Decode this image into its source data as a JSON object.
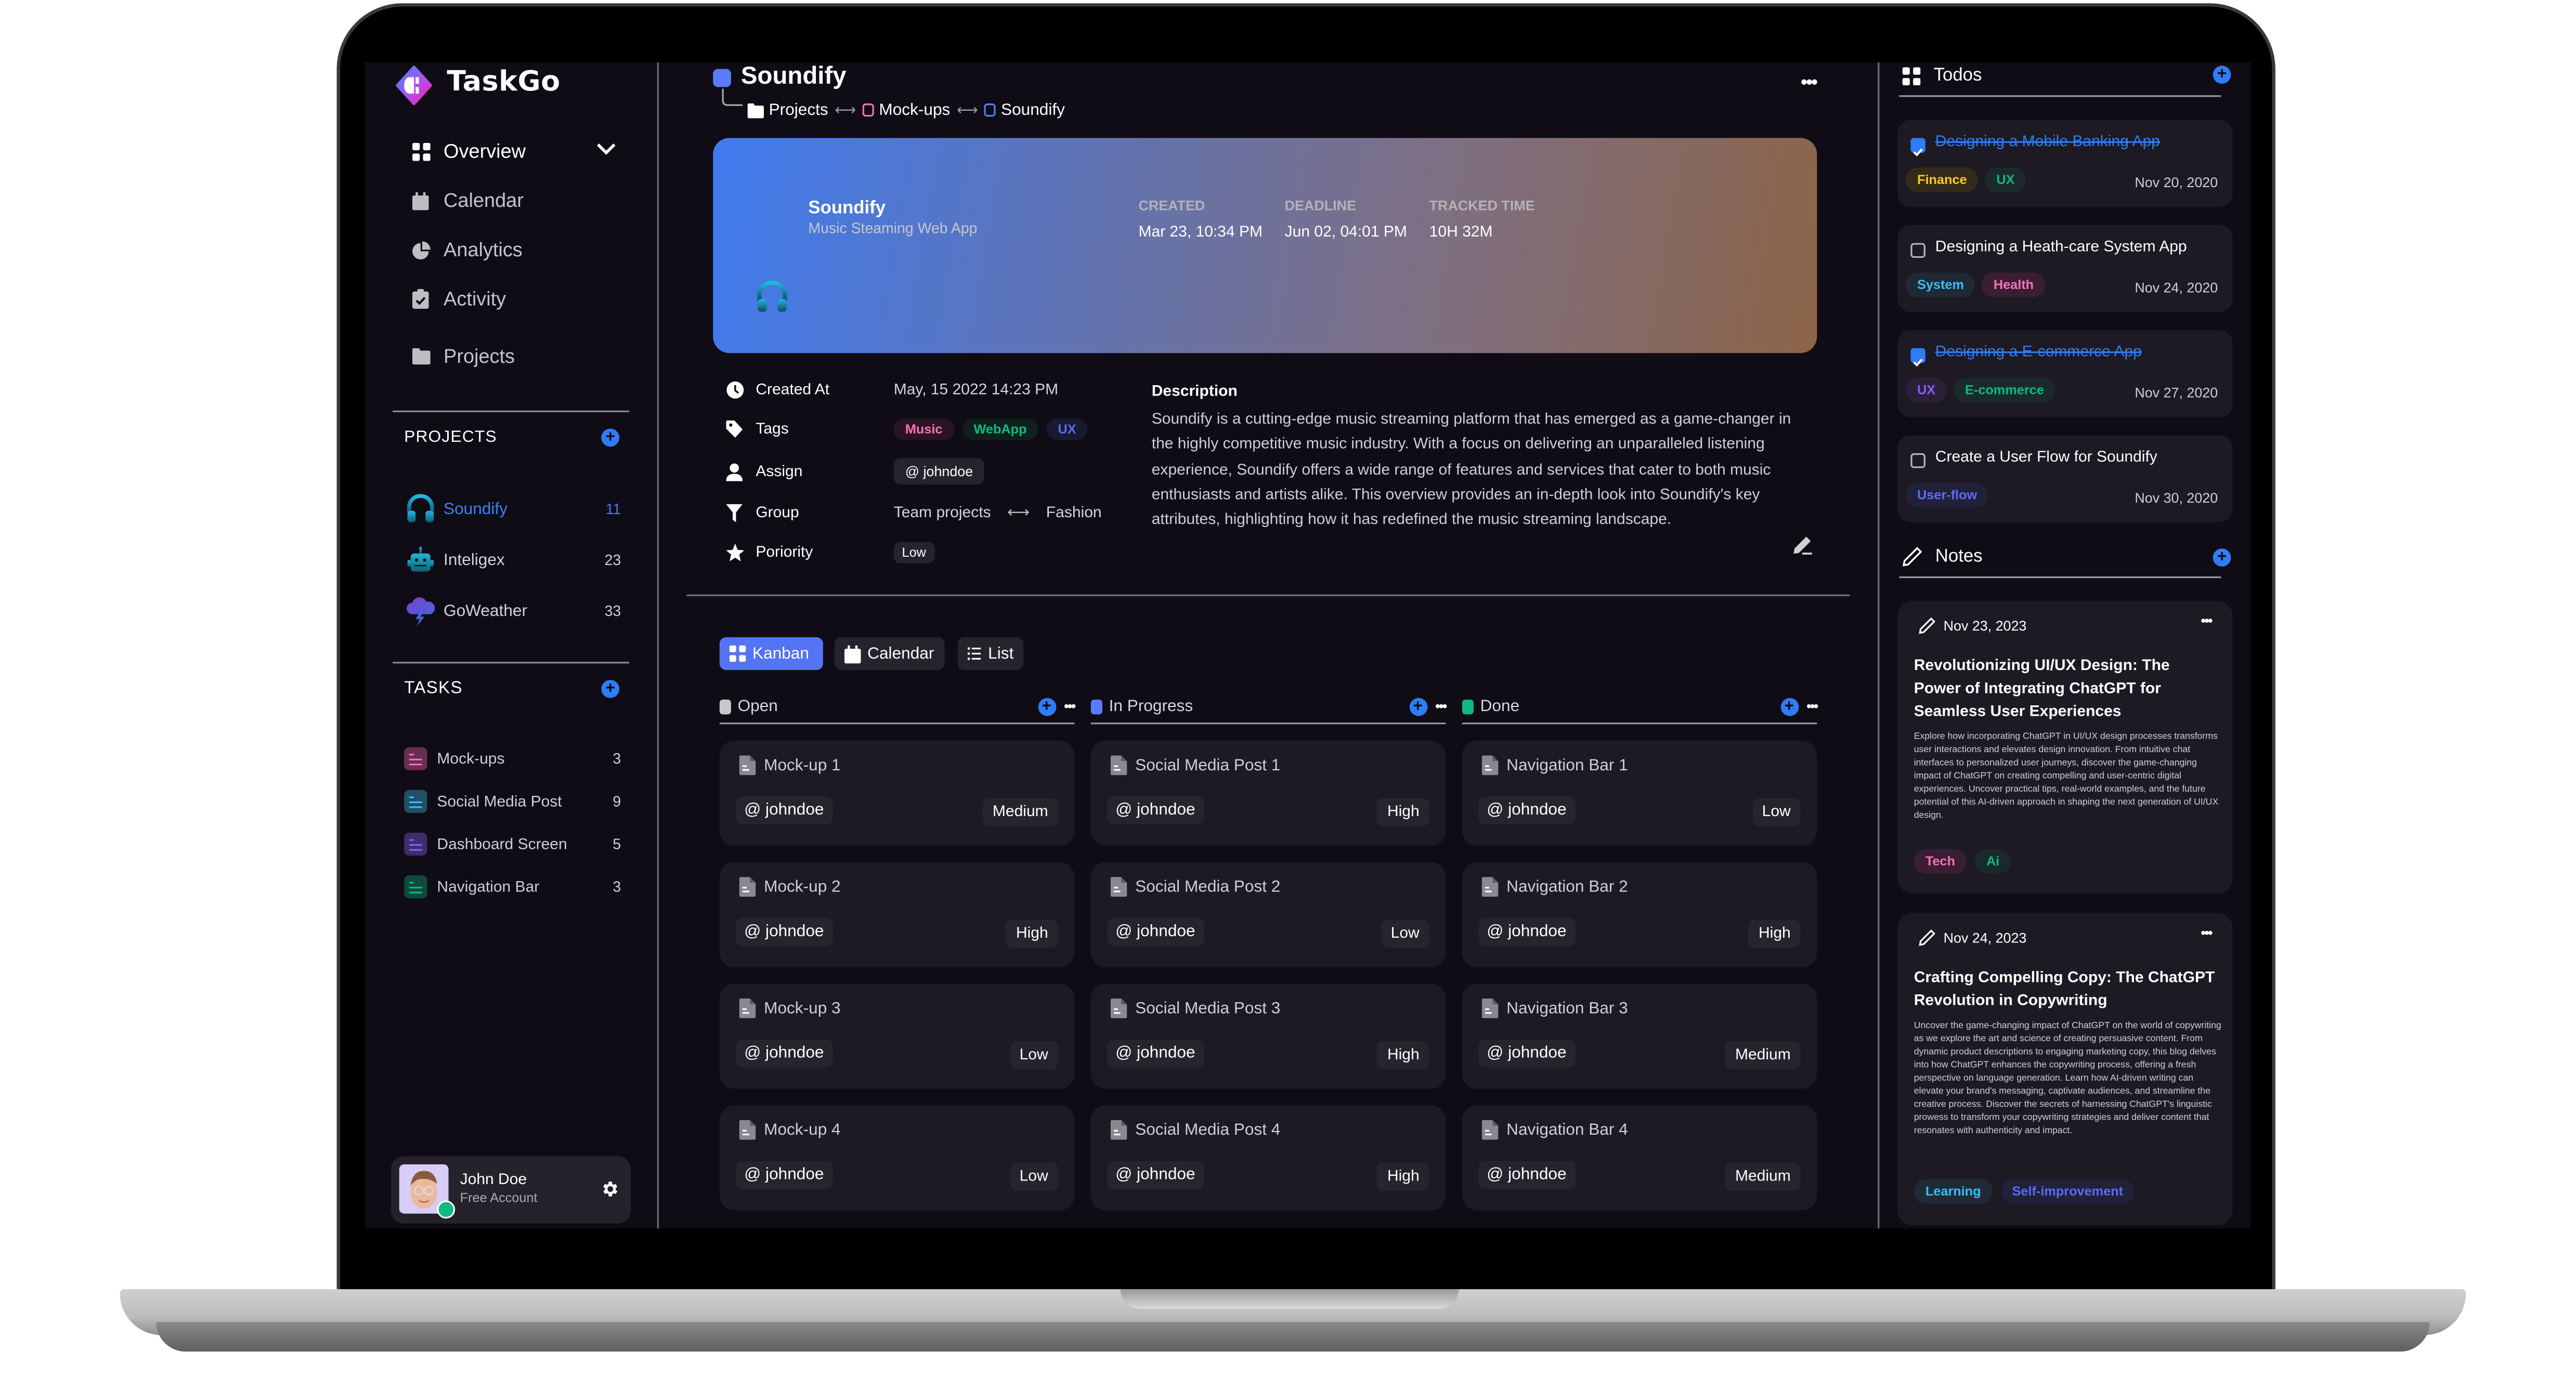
{
  "app": {
    "name": "TaskGo"
  },
  "sidebar": {
    "nav": [
      {
        "label": "Overview",
        "icon": "grid-icon",
        "active": true,
        "expandable": true
      },
      {
        "label": "Calendar",
        "icon": "calendar-icon"
      },
      {
        "label": "Analytics",
        "icon": "pie-chart-icon"
      },
      {
        "label": "Activity",
        "icon": "clipboard-check-icon"
      },
      {
        "label": "Projects",
        "icon": "folder-icon"
      }
    ],
    "projects_title": "PROJECTS",
    "projects": [
      {
        "name": "Soundify",
        "count": "11",
        "icon": "headphones-icon",
        "active": true
      },
      {
        "name": "Inteligex",
        "count": "23",
        "icon": "robot-icon"
      },
      {
        "name": "GoWeather",
        "count": "33",
        "icon": "storm-cloud-icon"
      }
    ],
    "tasks_title": "TASKS",
    "tasks": [
      {
        "name": "Mock-ups",
        "count": "3",
        "bg": "#6b2d50",
        "fg": "#f472b6"
      },
      {
        "name": "Social Media Post",
        "count": "9",
        "bg": "#1e5068",
        "fg": "#38bdf8"
      },
      {
        "name": "Dashboard Screen",
        "count": "5",
        "bg": "#3a2e6b",
        "fg": "#8b5cf6"
      },
      {
        "name": "Navigation Bar",
        "count": "3",
        "bg": "#0f4a3a",
        "fg": "#10b981"
      }
    ],
    "user": {
      "name": "John Doe",
      "plan": "Free Account",
      "status": "online"
    }
  },
  "main": {
    "title": "Soundify",
    "breadcrumb": [
      {
        "label": "Projects",
        "icon": "folder-icon"
      },
      {
        "label": "Mock-ups",
        "color": "#f472b6"
      },
      {
        "label": "Soundify",
        "color": "#5b7cfa"
      }
    ],
    "hero": {
      "name": "Soundify",
      "subtitle": "Music Steaming Web App",
      "created_label": "CREATED",
      "created": "Mar 23, 10:34 PM",
      "deadline_label": "DEADLINE",
      "deadline": "Jun 02, 04:01 PM",
      "tracked_label": "TRACKED TIME",
      "tracked": "10H 32M"
    },
    "properties": {
      "created_at_label": "Created At",
      "created_at": "May, 15 2022 14:23 PM",
      "tags_label": "Tags",
      "tags": [
        {
          "label": "Music",
          "color": "#f472b6",
          "bg": "#2a1424"
        },
        {
          "label": "WebApp",
          "color": "#10b981",
          "bg": "#10201d"
        },
        {
          "label": "UX",
          "color": "#5b6cf5",
          "bg": "#191a30"
        }
      ],
      "assign_label": "Assign",
      "assignee": "@ johndoe",
      "group_label": "Group",
      "group_from": "Team projects",
      "group_to": "Fashion",
      "priority_label": "Poriority",
      "priority": "Low"
    },
    "description_title": "Description",
    "description": "Soundify is a cutting-edge music streaming platform that has emerged as a game-changer in the highly competitive music industry. With a focus on delivering an unparalleled listening experience, Soundify offers a wide range of features and services that cater to both music enthusiasts and artists alike. This overview provides an in-depth look into Soundify's key attributes, highlighting how it has redefined the music streaming landscape.",
    "views": [
      {
        "label": "Kanban",
        "active": true
      },
      {
        "label": "Calendar"
      },
      {
        "label": "List"
      }
    ],
    "columns": [
      {
        "title": "Open",
        "color": "#c8c8cc",
        "cards": [
          {
            "title": "Mock-up 1",
            "assignee": "@ johndoe",
            "priority": "Medium"
          },
          {
            "title": "Mock-up 2",
            "assignee": "@ johndoe",
            "priority": "High"
          },
          {
            "title": "Mock-up 3",
            "assignee": "@ johndoe",
            "priority": "Low"
          },
          {
            "title": "Mock-up 4",
            "assignee": "@ johndoe",
            "priority": "Low"
          }
        ]
      },
      {
        "title": "In Progress",
        "color": "#5b7cfa",
        "cards": [
          {
            "title": "Social Media Post 1",
            "assignee": "@ johndoe",
            "priority": "High"
          },
          {
            "title": "Social Media Post 2",
            "assignee": "@ johndoe",
            "priority": "Low"
          },
          {
            "title": "Social Media Post 3",
            "assignee": "@ johndoe",
            "priority": "High"
          },
          {
            "title": "Social Media Post 4",
            "assignee": "@ johndoe",
            "priority": "High"
          }
        ]
      },
      {
        "title": "Done",
        "color": "#10b981",
        "cards": [
          {
            "title": "Navigation Bar 1",
            "assignee": "@ johndoe",
            "priority": "Low"
          },
          {
            "title": "Navigation Bar 2",
            "assignee": "@ johndoe",
            "priority": "High"
          },
          {
            "title": "Navigation Bar 3",
            "assignee": "@ johndoe",
            "priority": "Medium"
          },
          {
            "title": "Navigation Bar 4",
            "assignee": "@ johndoe",
            "priority": "Medium"
          }
        ]
      }
    ]
  },
  "todos": {
    "title": "Todos",
    "items": [
      {
        "title": "Designing a Mobile Banking App",
        "done": true,
        "date": "Nov 20, 2020",
        "tags": [
          {
            "label": "Finance",
            "color": "#facc15",
            "bg": "#332a1c"
          },
          {
            "label": "UX",
            "color": "#10b981",
            "bg": "#1a2a2a"
          }
        ]
      },
      {
        "title": "Designing a Heath-care System App",
        "done": false,
        "date": "Nov 24, 2020",
        "tags": [
          {
            "label": "System",
            "color": "#38bdf8",
            "bg": "#1f2a36"
          },
          {
            "label": "Health",
            "color": "#f472b6",
            "bg": "#3a1e33"
          }
        ]
      },
      {
        "title": "Designing a E-commerce App",
        "done": true,
        "date": "Nov 27, 2020",
        "tags": [
          {
            "label": "UX",
            "color": "#8b5cf6",
            "bg": "#2a2138"
          },
          {
            "label": "E-commerce",
            "color": "#10b981",
            "bg": "#1a2a2a"
          }
        ]
      },
      {
        "title": "Create a User Flow for Soundify",
        "done": false,
        "date": "Nov 30, 2020",
        "tags": [
          {
            "label": "User-flow",
            "color": "#5b6cf5",
            "bg": "#21213a"
          }
        ]
      }
    ]
  },
  "notes": {
    "title": "Notes",
    "items": [
      {
        "date": "Nov 23, 2023",
        "title": "Revolutionizing UI/UX Design: The Power of Integrating ChatGPT for Seamless User Experiences",
        "body": "Explore how incorporating ChatGPT in UI/UX design processes transforms user interactions and elevates design innovation. From intuitive chat interfaces to personalized user journeys, discover the game-changing impact of ChatGPT on creating compelling and user-centric digital experiences. Uncover practical tips, real-world examples, and the future potential of this AI-driven approach in shaping the next generation of UI/UX design.",
        "tags": [
          {
            "label": "Tech",
            "color": "#f472b6",
            "bg": "#3a1e33"
          },
          {
            "label": "Ai",
            "color": "#10b981",
            "bg": "#1a2a2a"
          }
        ]
      },
      {
        "date": "Nov 24, 2023",
        "title": "Crafting Compelling Copy: The ChatGPT Revolution in Copywriting",
        "body": "Uncover the game-changing impact of ChatGPT on the world of copywriting as we explore the art and science of creating persuasive content. From dynamic product descriptions to engaging marketing copy, this blog delves into how ChatGPT enhances the copywriting process, offering a fresh perspective on language generation. Learn how AI-driven writing can elevate your brand's messaging, captivate audiences, and streamline the creative process. Discover the secrets of harnessing ChatGPT's linguistic prowess to transform your copywriting strategies and deliver content that resonates with authenticity and impact.",
        "tags": [
          {
            "label": "Learning",
            "color": "#38bdf8",
            "bg": "#1f2a36"
          },
          {
            "label": "Self-improvement",
            "color": "#5b6cf5",
            "bg": "#21213a"
          }
        ]
      }
    ]
  },
  "colors": {
    "accent": "#2f7cf6",
    "kanban_active": "#5473f5",
    "background": "#0f0c15",
    "card": "#1d1a23"
  }
}
